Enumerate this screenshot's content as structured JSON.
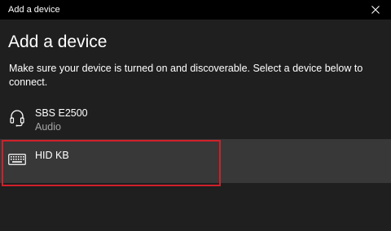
{
  "window": {
    "title": "Add a device",
    "close_icon": "close-icon"
  },
  "main": {
    "heading": "Add a device",
    "description": "Make sure your device is turned on and discoverable. Select a device below to connect."
  },
  "devices": [
    {
      "name": "SBS E2500",
      "type": "Audio",
      "icon": "headset-icon"
    },
    {
      "name": "HID KB",
      "type": "",
      "icon": "keyboard-icon"
    }
  ],
  "colors": {
    "background": "#1f1f1f",
    "title_bar": "#000000",
    "selected_row": "#383838",
    "highlight_border": "#d0202a",
    "secondary_text": "#a6a6a6"
  }
}
